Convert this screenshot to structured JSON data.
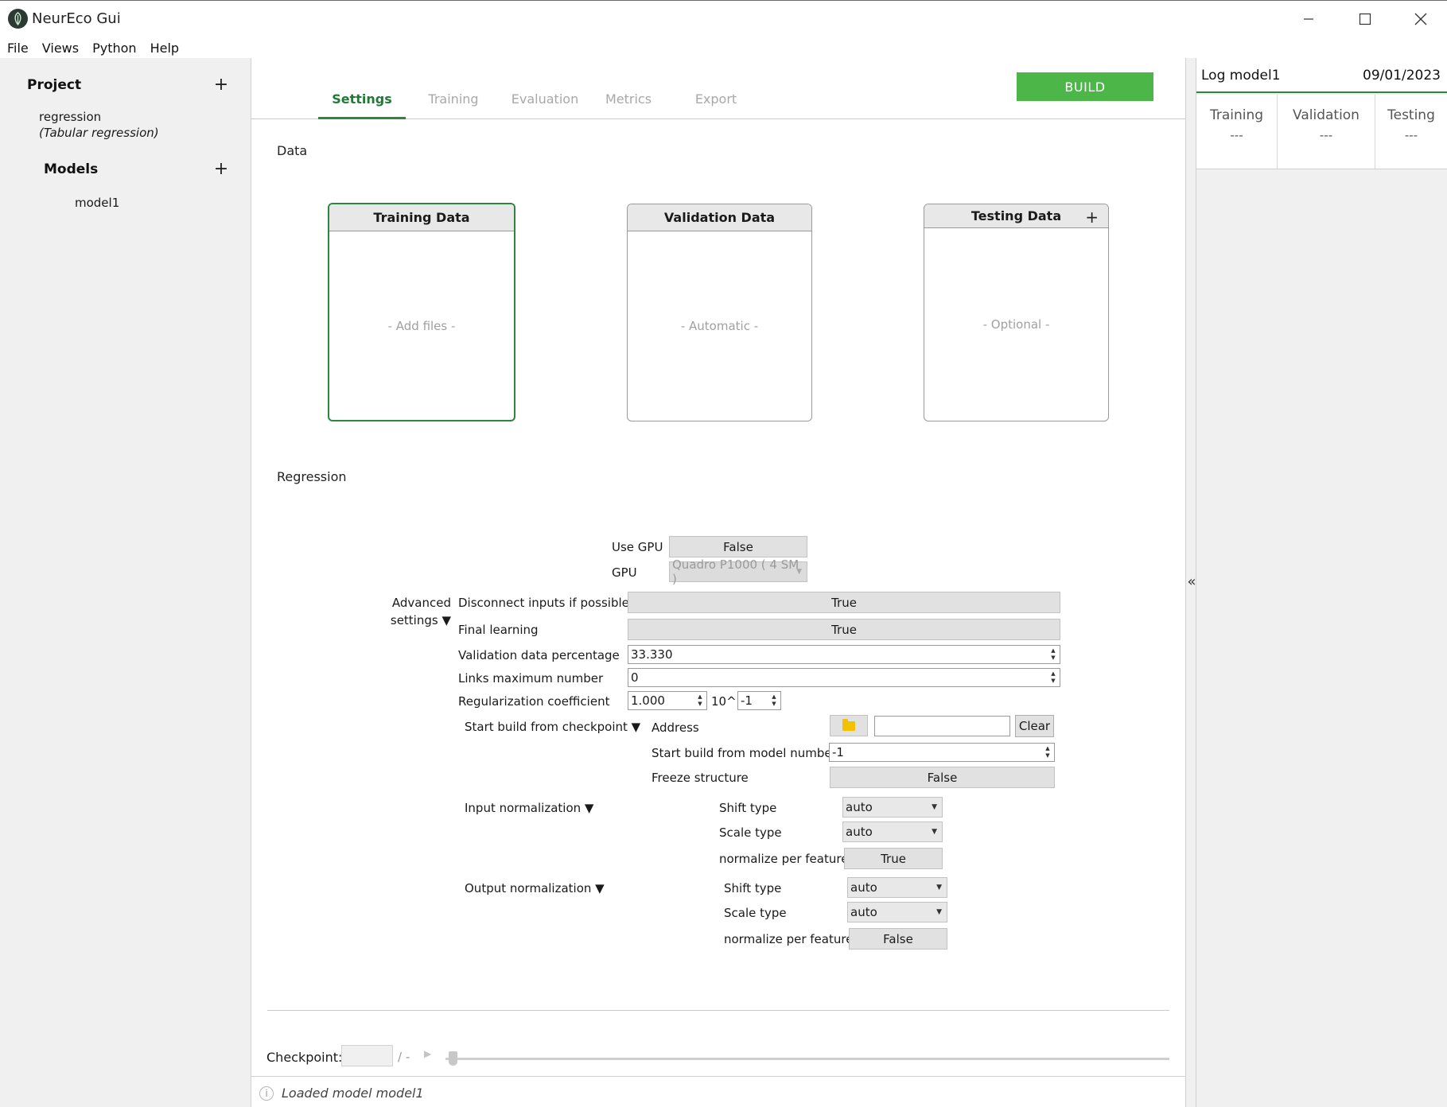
{
  "window": {
    "title": "NeurEco Gui"
  },
  "menu": [
    "File",
    "Views",
    "Python",
    "Help"
  ],
  "left_panel": {
    "project_title": "Project",
    "project_name": "regression",
    "project_type": "(Tabular regression)",
    "models_title": "Models",
    "models": [
      "model1"
    ],
    "add_icon": "plus-icon"
  },
  "tabs": [
    {
      "label": "Settings",
      "active": true
    },
    {
      "label": "Training",
      "active": false
    },
    {
      "label": "Evaluation",
      "active": false
    },
    {
      "label": "Metrics",
      "active": false
    },
    {
      "label": "Export",
      "active": false
    }
  ],
  "build_label": "BUILD",
  "accent_color": "#2e8540",
  "build_color": "#4cb649",
  "data_section": {
    "label": "Data",
    "cards": [
      {
        "title": "Training Data",
        "placeholder": "- Add files -",
        "selected": true
      },
      {
        "title": "Validation Data",
        "placeholder": "- Automatic -",
        "selected": false
      },
      {
        "title": "Testing Data",
        "placeholder": "- Optional -",
        "selected": false,
        "has_add": true
      }
    ]
  },
  "regression": {
    "label": "Regression",
    "use_gpu_label": "Use GPU",
    "use_gpu_value": "False",
    "gpu_label": "GPU",
    "gpu_value": "Quadro P1000 ( 4 SM )",
    "advanced_label_1": "Advanced",
    "advanced_label_2": "settings ▼",
    "disconnect_label": "Disconnect inputs if possible",
    "disconnect_value": "True",
    "final_learning_label": "Final learning",
    "final_learning_value": "True",
    "val_pct_label": "Validation data percentage",
    "val_pct_value": "33.330",
    "links_max_label": "Links maximum number",
    "links_max_value": "0",
    "reg_coef_label": "Regularization coefficient",
    "reg_coef_value": "1.000",
    "reg_exp_label": "10^",
    "reg_exp_value": "-1",
    "checkpoint_section_label": "Start build from checkpoint ▼",
    "address_label": "Address",
    "clear_label": "Clear",
    "model_number_label": "Start build from model number",
    "model_number_value": "-1",
    "freeze_label": "Freeze structure",
    "freeze_value": "False",
    "input_norm": {
      "section_label": "Input normalization ▼",
      "shift_label": "Shift type",
      "shift_value": "auto",
      "scale_label": "Scale type",
      "scale_value": "auto",
      "per_feature_label": "normalize per feature",
      "per_feature_value": "True"
    },
    "output_norm": {
      "section_label": "Output normalization ▼",
      "shift_label": "Shift type",
      "shift_value": "auto",
      "scale_label": "Scale type",
      "scale_value": "auto",
      "per_feature_label": "normalize per feature",
      "per_feature_value": "False"
    }
  },
  "checkpoint_bar": {
    "label": "Checkpoint:",
    "input_value": "",
    "total": "/ -"
  },
  "status": {
    "text": "Loaded model model1"
  },
  "log_panel": {
    "title": "Log model1",
    "date": "09/01/2023",
    "metrics": [
      {
        "name": "Training",
        "value": "---"
      },
      {
        "name": "Validation",
        "value": "---"
      },
      {
        "name": "Testing",
        "value": "---"
      }
    ]
  }
}
